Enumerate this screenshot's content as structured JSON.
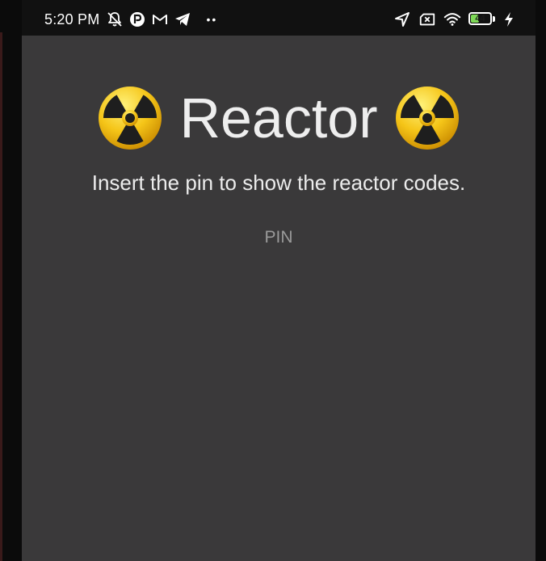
{
  "status_bar": {
    "time": "5:20 PM",
    "overflow_dots": "••",
    "battery_level": "44",
    "battery_fraction": 0.44,
    "left_icons": [
      "muted-bell-icon",
      "app-p-icon",
      "gmail-icon",
      "telegram-icon"
    ],
    "right_icons": [
      "location-arrow-icon",
      "no-sim-icon",
      "wifi-icon",
      "battery-icon",
      "charging-bolt-icon"
    ]
  },
  "app": {
    "title": "Reactor",
    "title_icon": "radiation-icon",
    "subtitle": "Insert the pin to show the reactor codes.",
    "pin": {
      "placeholder": "PIN",
      "value": ""
    }
  },
  "colors": {
    "background": "#3a393a",
    "status_bar": "#111111",
    "title_text": "#eeeeee",
    "placeholder": "#9a9a9a",
    "battery_fill": "#7ed957",
    "radiation_yellow": "#f5c518"
  }
}
